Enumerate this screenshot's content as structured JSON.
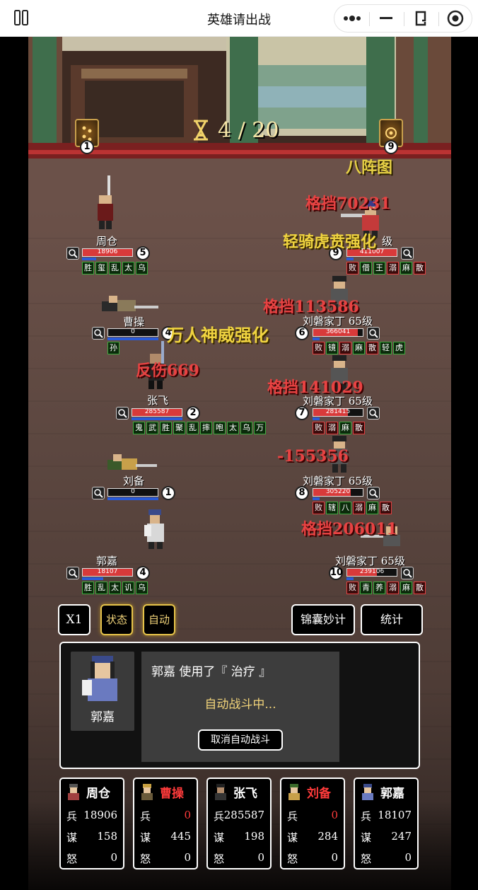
{
  "topbar": {
    "title": "英雄请出战"
  },
  "battle": {
    "round": "4 / 20",
    "left_formation_count": "1",
    "right_formation_count": "9",
    "formation_name": "八阵图"
  },
  "allies": [
    {
      "name": "周仓",
      "hp": "18906",
      "hp_frac": 1.0,
      "slot": "5",
      "badges": [
        "胜",
        "玺",
        "乱",
        "太",
        "乌"
      ]
    },
    {
      "name": "曹操",
      "hp": "0",
      "hp_frac": 0.0,
      "slot": "4",
      "badges": [
        "孙"
      ]
    },
    {
      "name": "张飞",
      "hp": "285587",
      "hp_frac": 1.0,
      "slot": "2",
      "badges": [
        "鬼",
        "武",
        "胜",
        "聚",
        "乱",
        "摔",
        "咆",
        "太",
        "乌",
        "万"
      ]
    },
    {
      "name": "刘备",
      "hp": "0",
      "hp_frac": 0.0,
      "slot": "1",
      "badges": []
    },
    {
      "name": "郭嘉",
      "hp": "18107",
      "hp_frac": 1.0,
      "slot": "4",
      "badges": [
        "胜",
        "乱",
        "太",
        "讥",
        "乌"
      ]
    }
  ],
  "enemies": [
    {
      "name": "刘磐家丁 65级",
      "name_short": "级",
      "hp": "411007",
      "hp_frac": 1.0,
      "slot": "9",
      "badges": [
        "败",
        "借",
        "王",
        "溺",
        "麻",
        "散"
      ]
    },
    {
      "name": "刘磐家丁 65级",
      "hp": "366041",
      "hp_frac": 0.9,
      "slot": "6",
      "badges": [
        "败",
        "镜",
        "溺",
        "麻",
        "散",
        "轻",
        "虎"
      ]
    },
    {
      "name": "刘磐家丁 65级",
      "hp": "281415",
      "hp_frac": 0.7,
      "slot": "7",
      "badges": [
        "败",
        "溺",
        "麻",
        "散"
      ]
    },
    {
      "name": "刘磐家丁 65级",
      "hp": "305220",
      "hp_frac": 0.75,
      "slot": "8",
      "badges": [
        "败",
        "辖",
        "八",
        "溺",
        "麻",
        "散"
      ]
    },
    {
      "name": "刘磐家丁 65级",
      "hp": "239106",
      "hp_frac": 0.6,
      "slot": "10",
      "badges": [
        "败",
        "青",
        "养",
        "溺",
        "麻",
        "散"
      ]
    }
  ],
  "floats": {
    "f1": "格挡70231",
    "f2": "轻骑虎贲强化",
    "f3": "格挡113586",
    "f4": "万人神威强化",
    "f5": "反伤669",
    "f6": "格挡141029",
    "f7": "-155356",
    "f8": "格挡206011"
  },
  "controls": {
    "speed": "X1",
    "status": "状态",
    "auto": "自动",
    "tips": "锦囊妙计",
    "stats": "统计"
  },
  "log": {
    "portrait_name": "郭嘉",
    "message": "郭嘉 使用了『 治疗 』",
    "auto_text": "自动战斗中...",
    "cancel_label": "取消自动战斗"
  },
  "stat_labels": {
    "troops": "兵",
    "strategy": "谋",
    "rage": "怒"
  },
  "heroes": [
    {
      "name": "周仓",
      "troops": "18906",
      "strategy": "158",
      "rage": "0"
    },
    {
      "name": "曹操",
      "troops": "0",
      "strategy": "445",
      "rage": "0"
    },
    {
      "name": "张飞",
      "troops": "285587",
      "strategy": "198",
      "rage": "0"
    },
    {
      "name": "刘备",
      "troops": "0",
      "strategy": "284",
      "rage": "0"
    },
    {
      "name": "郭嘉",
      "troops": "18107",
      "strategy": "247",
      "rage": "0"
    }
  ],
  "colors": {
    "accent_gold": "#e5c34a",
    "hp_red": "#d83a3a",
    "buff_green": "#3faa3f",
    "debuff_red": "#e04040",
    "dead_red": "#ff3b3b"
  }
}
